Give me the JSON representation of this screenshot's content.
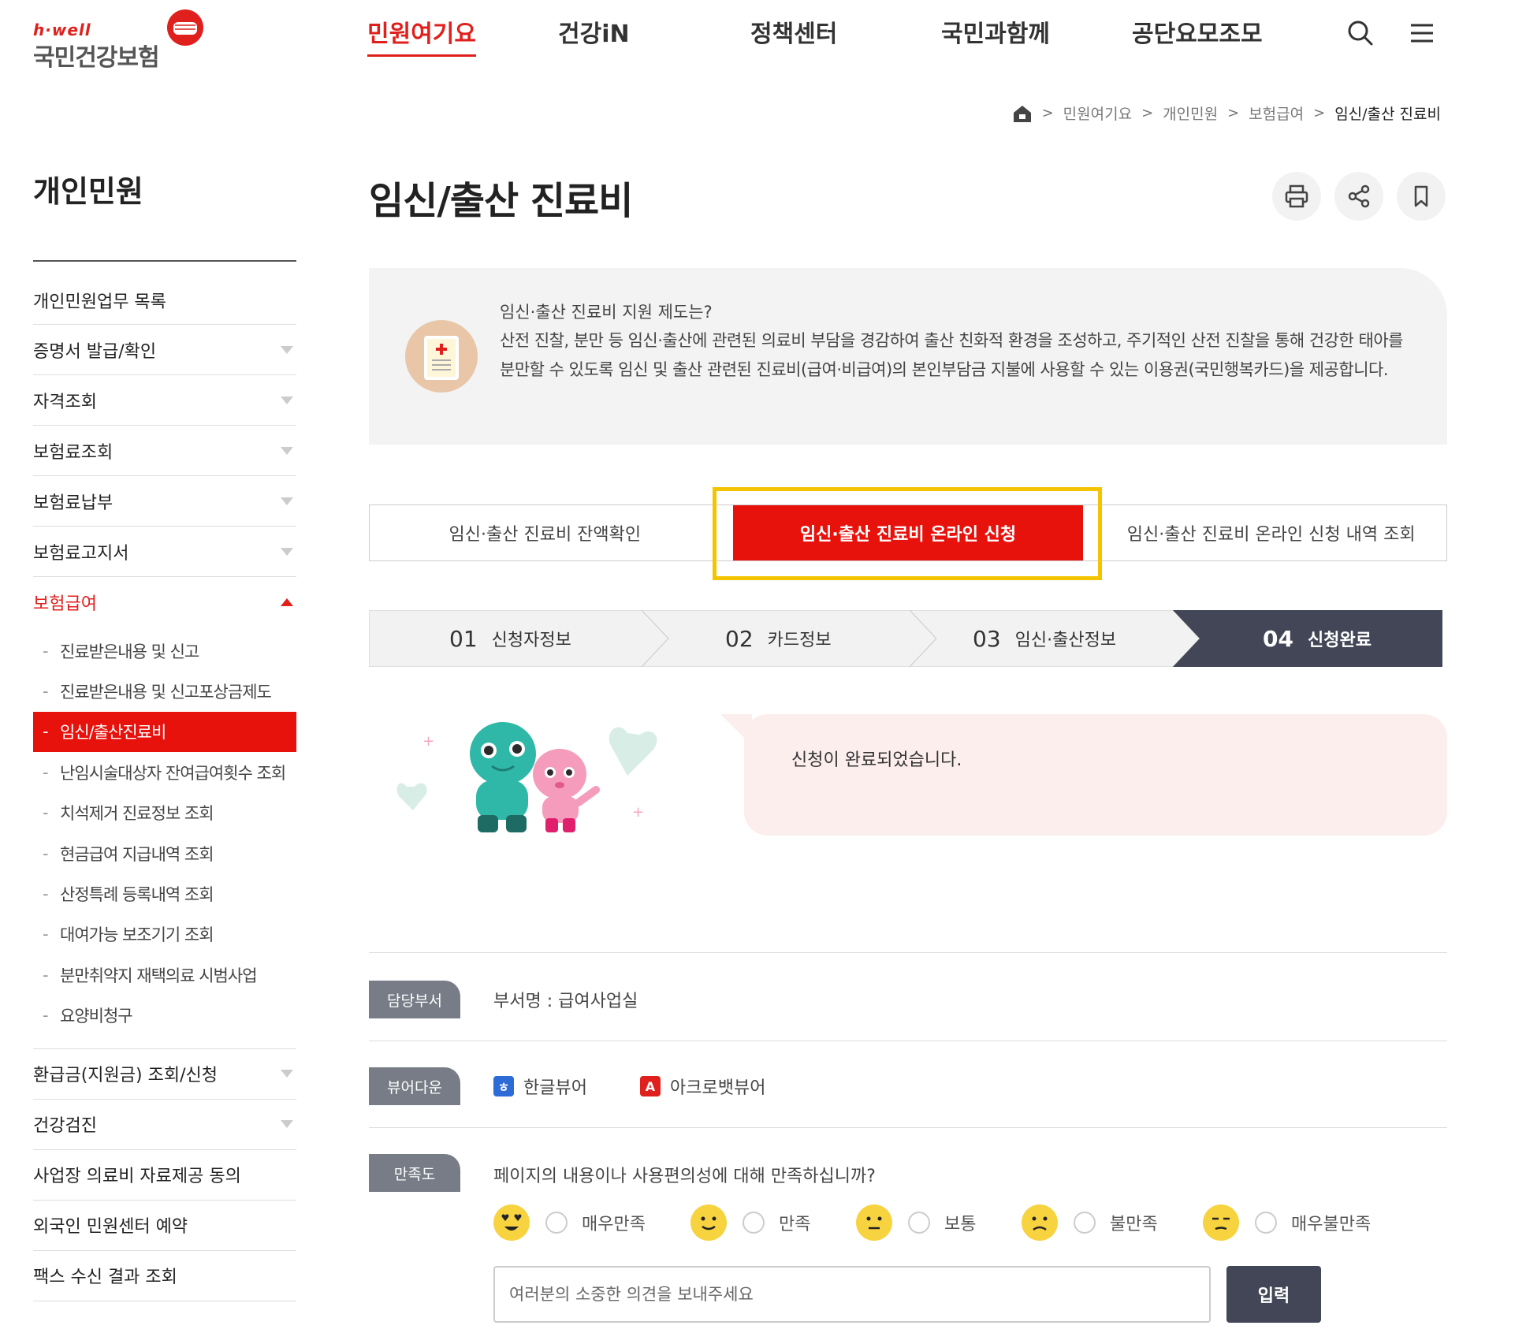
{
  "logo": {
    "small": "h·well",
    "main": "국민건강보험"
  },
  "gnb": [
    "민원여기요",
    "건강iN",
    "정책센터",
    "국민과함께",
    "공단요모조모"
  ],
  "breadcrumb": [
    "민원여기요",
    "개인민원",
    "보험급여",
    "임신/출산 진료비"
  ],
  "sidebar": {
    "title": "개인민원",
    "items": [
      {
        "label": "개인민원업무 목록"
      },
      {
        "label": "증명서 발급/확인"
      },
      {
        "label": "자격조회"
      },
      {
        "label": "보험료조회"
      },
      {
        "label": "보험료납부"
      },
      {
        "label": "보험료고지서"
      },
      {
        "label": "보험급여"
      },
      {
        "label": "환급금(지원금) 조회/신청"
      },
      {
        "label": "건강검진"
      },
      {
        "label": "사업장 의료비 자료제공 동의"
      },
      {
        "label": "외국인 민원센터 예약"
      },
      {
        "label": "팩스 수신 결과 조회"
      }
    ],
    "sub_items": [
      "진료받은내용 및 신고",
      "진료받은내용 및 신고포상금제도",
      "임신/출산진료비",
      "난임시술대상자 잔여급여횟수 조회",
      "치석제거 진료정보 조회",
      "현금급여 지급내역 조회",
      "산정특례 등록내역 조회",
      "대여가능 보조기기 조회",
      "분만취약지 재택의료 시범사업",
      "요양비청구"
    ]
  },
  "main": {
    "title": "임신/출산 진료비",
    "intro_question": "임신·출산 진료비 지원 제도는?",
    "intro_text": "산전 진찰, 분만 등 임신·출산에 관련된 의료비 부담을 경감하여 출산 친화적 환경을 조성하고, 주기적인 산전 진찰을 통해 건강한 태아를 분만할 수 있도록 임신 및 출산 관련된 진료비(급여·비급여)의 본인부담금 지불에 사용할 수 있는 이용권(국민행복카드)을 제공합니다.",
    "tabs": [
      "임신·출산 진료비 잔액확인",
      "임신·출산 진료비 온라인 신청",
      "임신·출산 진료비 온라인 신청 내역 조회"
    ],
    "steps": [
      {
        "num": "01",
        "label": "신청자정보"
      },
      {
        "num": "02",
        "label": "카드정보"
      },
      {
        "num": "03",
        "label": "임신·출산정보"
      },
      {
        "num": "04",
        "label": "신청완료"
      }
    ],
    "complete_message": "신청이 완료되었습니다."
  },
  "footer": {
    "dept_label": "담당부서",
    "dept_value": "부서명 : 급여사업실",
    "viewer_label": "뷰어다운",
    "viewers": [
      "한글뷰어",
      "아크로뱃뷰어"
    ],
    "satisfaction_label": "만족도",
    "satisfaction_question": "페이지의 내용이나 사용편의성에 대해 만족하십니까?",
    "ratings": [
      "매우만족",
      "만족",
      "보통",
      "불만족",
      "매우불만족"
    ],
    "opinion_placeholder": "여러분의 소중한 의견을 보내주세요",
    "submit_label": "입력"
  },
  "colors": {
    "brand_red": "#e8120c",
    "dark": "#424656",
    "highlight": "#f5c400"
  }
}
